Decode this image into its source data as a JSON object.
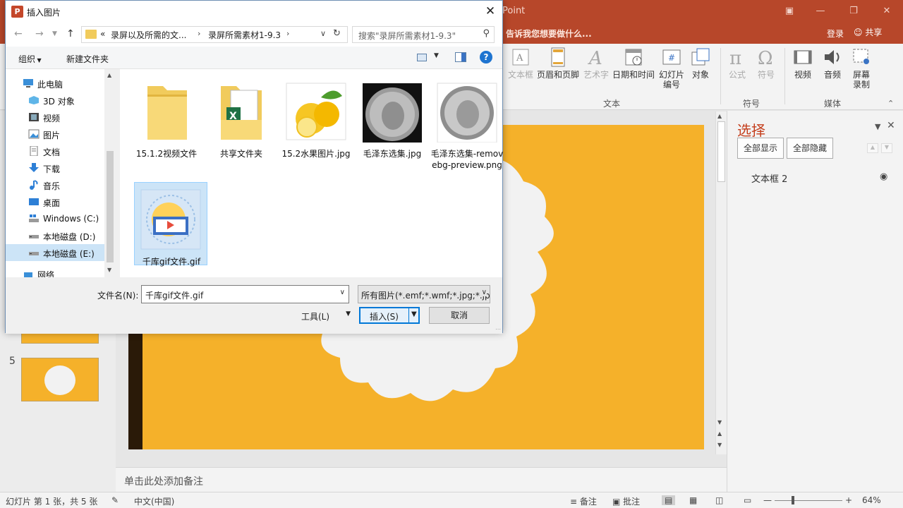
{
  "app": {
    "title_fragment": "Point",
    "tell_me": "告诉我您想要做什么...",
    "login": "登录",
    "share": "共享"
  },
  "ribbon": {
    "buttons": [
      {
        "label": "文本框",
        "icon": "textbox-icon"
      },
      {
        "label": "页眉和页脚",
        "icon": "header-footer-icon"
      },
      {
        "label": "艺术字",
        "icon": "wordart-icon"
      },
      {
        "label": "日期和时间",
        "icon": "calendar-icon"
      },
      {
        "label": "幻灯片\n编号",
        "icon": "slide-number-icon"
      },
      {
        "label": "对象",
        "icon": "object-icon"
      },
      {
        "label": "公式",
        "icon": "pi-icon"
      },
      {
        "label": "符号",
        "icon": "omega-icon"
      },
      {
        "label": "视频",
        "icon": "video-icon"
      },
      {
        "label": "音频",
        "icon": "audio-icon"
      },
      {
        "label": "屏幕\n录制",
        "icon": "screen-record-icon"
      }
    ],
    "groups": [
      "文本",
      "符号",
      "媒体"
    ]
  },
  "thumbnails": {
    "visible_number": "5"
  },
  "notes_placeholder": "单击此处添加备注",
  "selection_pane": {
    "title": "选择",
    "show_all": "全部显示",
    "hide_all": "全部隐藏",
    "items": [
      {
        "name": "文本框 2"
      }
    ]
  },
  "statusbar": {
    "slide_info": "幻灯片 第 1 张，共 5 张",
    "language": "中文(中国)",
    "notes": "备注",
    "comments": "批注",
    "zoom": "64%"
  },
  "dialog": {
    "title": "插入图片",
    "address": {
      "overflow": "«",
      "crumbs": [
        "录屏以及所需的文...",
        "录屏所需素材1-9.3"
      ]
    },
    "search_placeholder": "搜索\"录屏所需素材1-9.3\"",
    "toolbar": {
      "organize": "组织",
      "new_folder": "新建文件夹"
    },
    "nav_items": [
      {
        "label": "此电脑",
        "icon": "computer-icon"
      },
      {
        "label": "3D 对象",
        "icon": "3d-objects-icon"
      },
      {
        "label": "视频",
        "icon": "videos-folder-icon"
      },
      {
        "label": "图片",
        "icon": "pictures-folder-icon"
      },
      {
        "label": "文档",
        "icon": "documents-folder-icon"
      },
      {
        "label": "下载",
        "icon": "downloads-folder-icon"
      },
      {
        "label": "音乐",
        "icon": "music-folder-icon"
      },
      {
        "label": "桌面",
        "icon": "desktop-folder-icon"
      },
      {
        "label": "Windows (C:)",
        "icon": "windows-drive-icon"
      },
      {
        "label": "本地磁盘 (D:)",
        "icon": "drive-icon"
      },
      {
        "label": "本地磁盘 (E:)",
        "icon": "drive-icon",
        "selected": true
      },
      {
        "label": "网络",
        "icon": "network-icon"
      }
    ],
    "files": [
      {
        "name": "15.1.2视频文件",
        "kind": "folder"
      },
      {
        "name": "共享文件夹",
        "kind": "excel-folder"
      },
      {
        "name": "15.2水果图片.jpg",
        "kind": "lemon-image"
      },
      {
        "name": "毛泽东选集.jpg",
        "kind": "coin-dark-image"
      },
      {
        "name": "毛泽东选集-removebg-preview.png",
        "kind": "coin-light-image"
      },
      {
        "name": "千库gif文件.gif",
        "kind": "gif-image",
        "selected": true
      }
    ],
    "filename_label": "文件名(N):",
    "filename_value": "千库gif文件.gif",
    "filter_value": "所有图片(*.emf;*.wmf;*.jpg;*.jpeg;*.png)",
    "tools_label": "工具(L)",
    "insert_label": "插入(S)",
    "cancel_label": "取消"
  },
  "colors": {
    "ppt_accent": "#b7472a",
    "slide_bg": "#f5b12a",
    "selection": "#cce4f7"
  }
}
